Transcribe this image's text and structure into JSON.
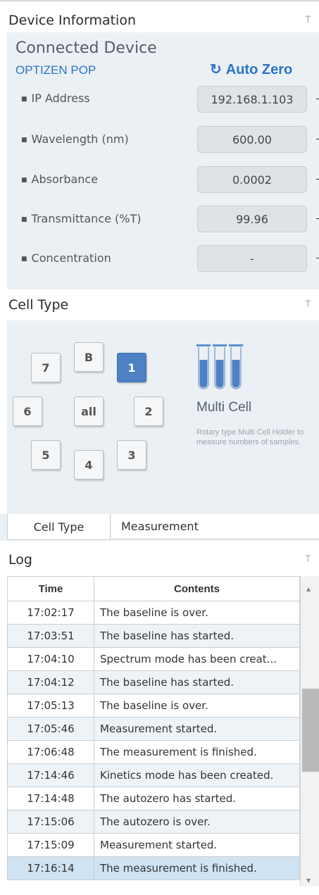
{
  "device_info": {
    "panel_title": "Device Information",
    "pin_glyph": "⍑",
    "connected_title": "Connected Device",
    "device_name": "OPTIZEN POP",
    "auto_zero_label": "Auto Zero",
    "fields": [
      {
        "label": "IP Address",
        "value": "192.168.1.103"
      },
      {
        "label": "Wavelength (nm)",
        "value": "600.00"
      },
      {
        "label": "Absorbance",
        "value": "0.0002"
      },
      {
        "label": "Transmittance (%T)",
        "value": "99.96"
      },
      {
        "label": "Concentration",
        "value": "-"
      }
    ]
  },
  "cell_type": {
    "panel_title": "Cell Type",
    "buttons": [
      "7",
      "B",
      "1",
      "6",
      "all",
      "2",
      "5",
      "4",
      "3"
    ],
    "selected": "1",
    "multi_title": "Multi Cell",
    "multi_desc": "Rotary type Multi Cell Holder to measure numbers of samples."
  },
  "tabs": {
    "cell_type": "Cell Type",
    "measurement": "Measurement"
  },
  "log": {
    "panel_title": "Log",
    "headers": [
      "Time",
      "Contents"
    ],
    "rows": [
      {
        "time": "17:02:17",
        "content": "The baseline is over."
      },
      {
        "time": "17:03:51",
        "content": "The baseline has started."
      },
      {
        "time": "17:04:10",
        "content": "Spectrum mode has been creat..."
      },
      {
        "time": "17:04:12",
        "content": "The baseline has started."
      },
      {
        "time": "17:05:13",
        "content": "The baseline is over."
      },
      {
        "time": "17:05:46",
        "content": "Measurement started."
      },
      {
        "time": "17:06:48",
        "content": "The measurement is finished."
      },
      {
        "time": "17:14:46",
        "content": "Kinetics mode has been created."
      },
      {
        "time": "17:14:48",
        "content": "The autozero has started."
      },
      {
        "time": "17:15:06",
        "content": "The autozero is over."
      },
      {
        "time": "17:15:09",
        "content": "Measurement started."
      },
      {
        "time": "17:16:14",
        "content": "The measurement is finished."
      }
    ],
    "selected_index": 11
  },
  "colors": {
    "accent": "#2c74c4",
    "selected_cell": "#4d81c4",
    "panel_bg": "#ebf0f4"
  }
}
